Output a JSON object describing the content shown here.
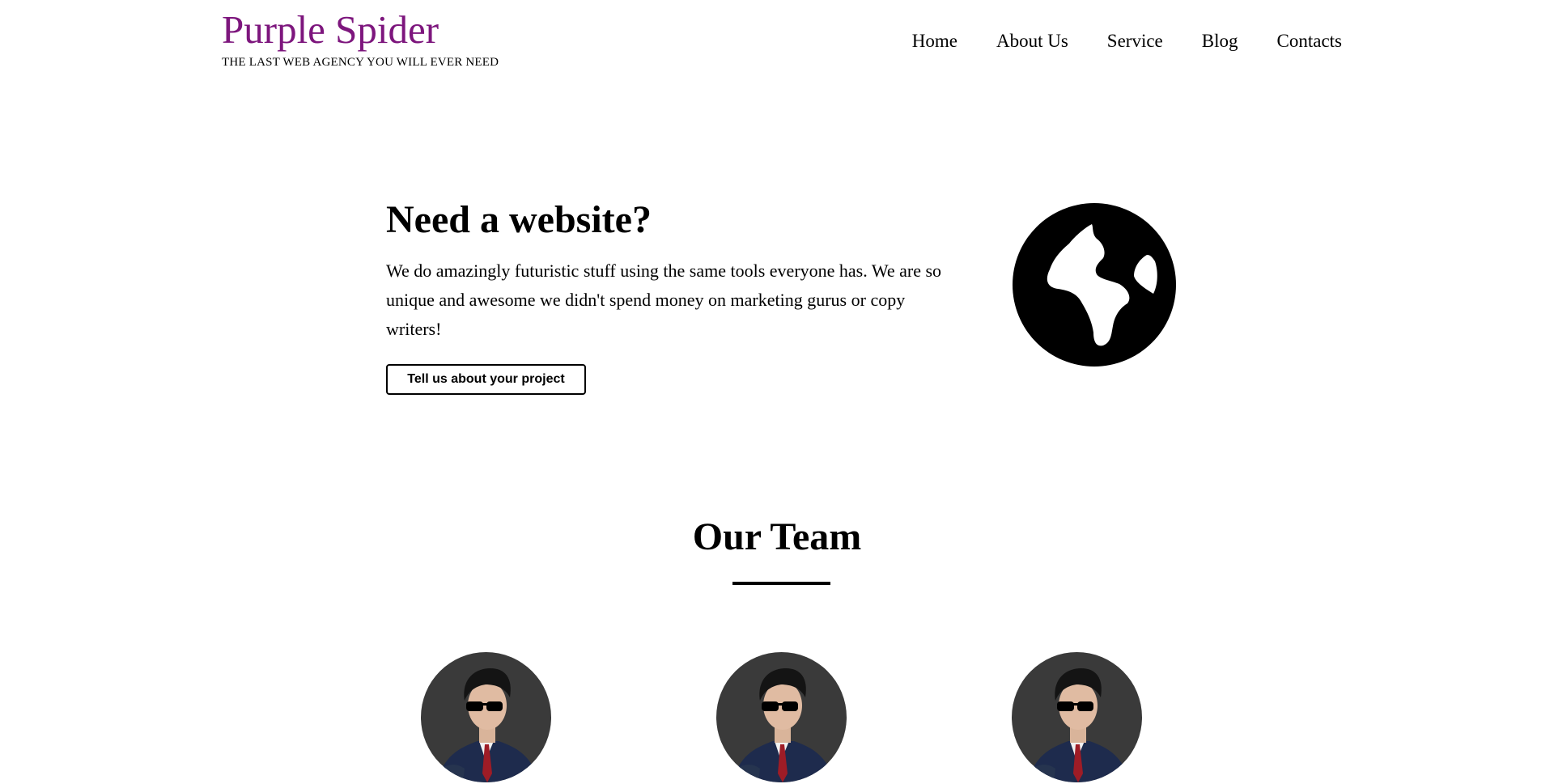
{
  "brand": {
    "title": "Purple Spider",
    "tagline": "THE LAST WEB AGENCY YOU WILL EVER NEED",
    "color": "#7d167d"
  },
  "nav": {
    "items": [
      "Home",
      "About Us",
      "Service",
      "Blog",
      "Contacts"
    ]
  },
  "hero": {
    "title": "Need a website?",
    "text": "We do amazingly futuristic stuff using the same tools everyone has. We are so unique and awesome we didn't spend money on marketing gurus or copy writers!",
    "cta_label": "Tell us about your project",
    "icon": "globe-icon"
  },
  "team": {
    "title": "Our Team",
    "members": [
      {
        "icon": "team-member-photo"
      },
      {
        "icon": "team-member-photo"
      },
      {
        "icon": "team-member-photo"
      }
    ]
  }
}
